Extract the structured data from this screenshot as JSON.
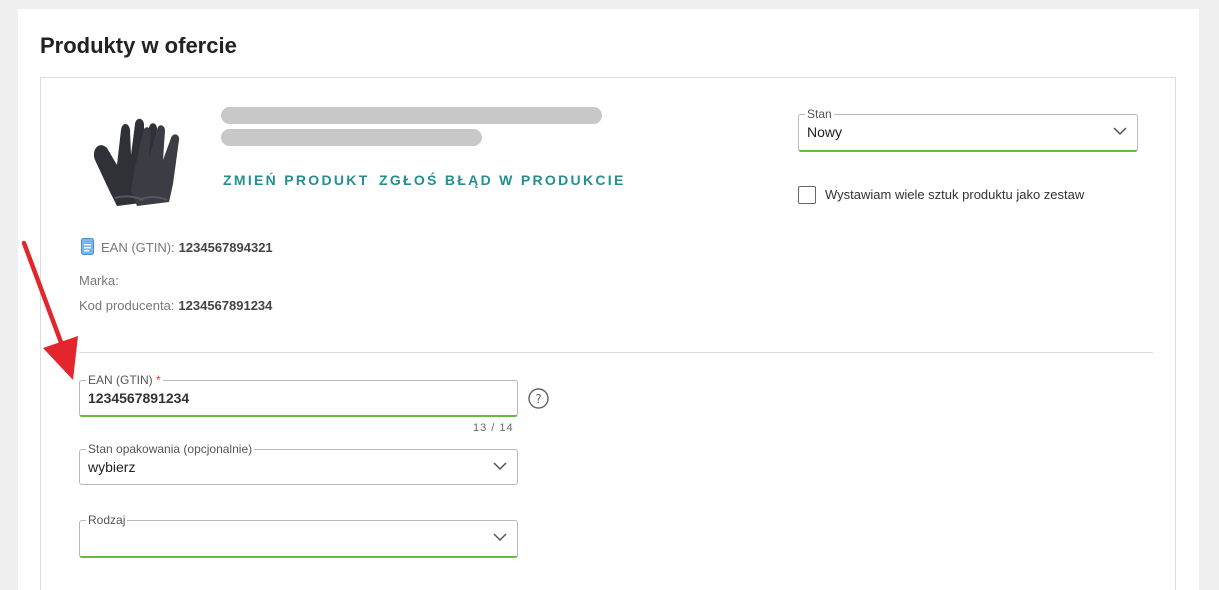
{
  "page": {
    "title": "Produkty w ofercie"
  },
  "product": {
    "actions": {
      "change": "ZMIEŃ PRODUKT",
      "report": "ZGŁOŚ BŁĄD W PRODUKCIE"
    },
    "meta": {
      "ean_label": "EAN (GTIN):",
      "ean_value": "1234567894321",
      "brand_label": "Marka:",
      "brand_value": "",
      "producer_code_label": "Kod producenta:",
      "producer_code_value": "1234567891234"
    }
  },
  "condition": {
    "label": "Stan",
    "value": "Nowy"
  },
  "set_checkbox": {
    "label": "Wystawiam wiele sztuk produktu jako zestaw",
    "checked": false
  },
  "ean_field": {
    "label": "EAN (GTIN)",
    "required_mark": "*",
    "value": "1234567891234",
    "counter": "13 / 14"
  },
  "package_field": {
    "label": "Stan opakowania (opcjonalnie)",
    "value": "wybierz"
  },
  "type_field": {
    "label": "Rodzaj",
    "value": ""
  },
  "colors": {
    "accent_link": "#248f8f",
    "valid_border": "#6aba3f",
    "required": "#e0362f",
    "annotation_arrow": "#e3262e"
  },
  "icons": {
    "product_image": "gloves-image",
    "ean": "document-icon",
    "help": "question-circle-icon",
    "dropdown": "chevron-down-icon"
  }
}
